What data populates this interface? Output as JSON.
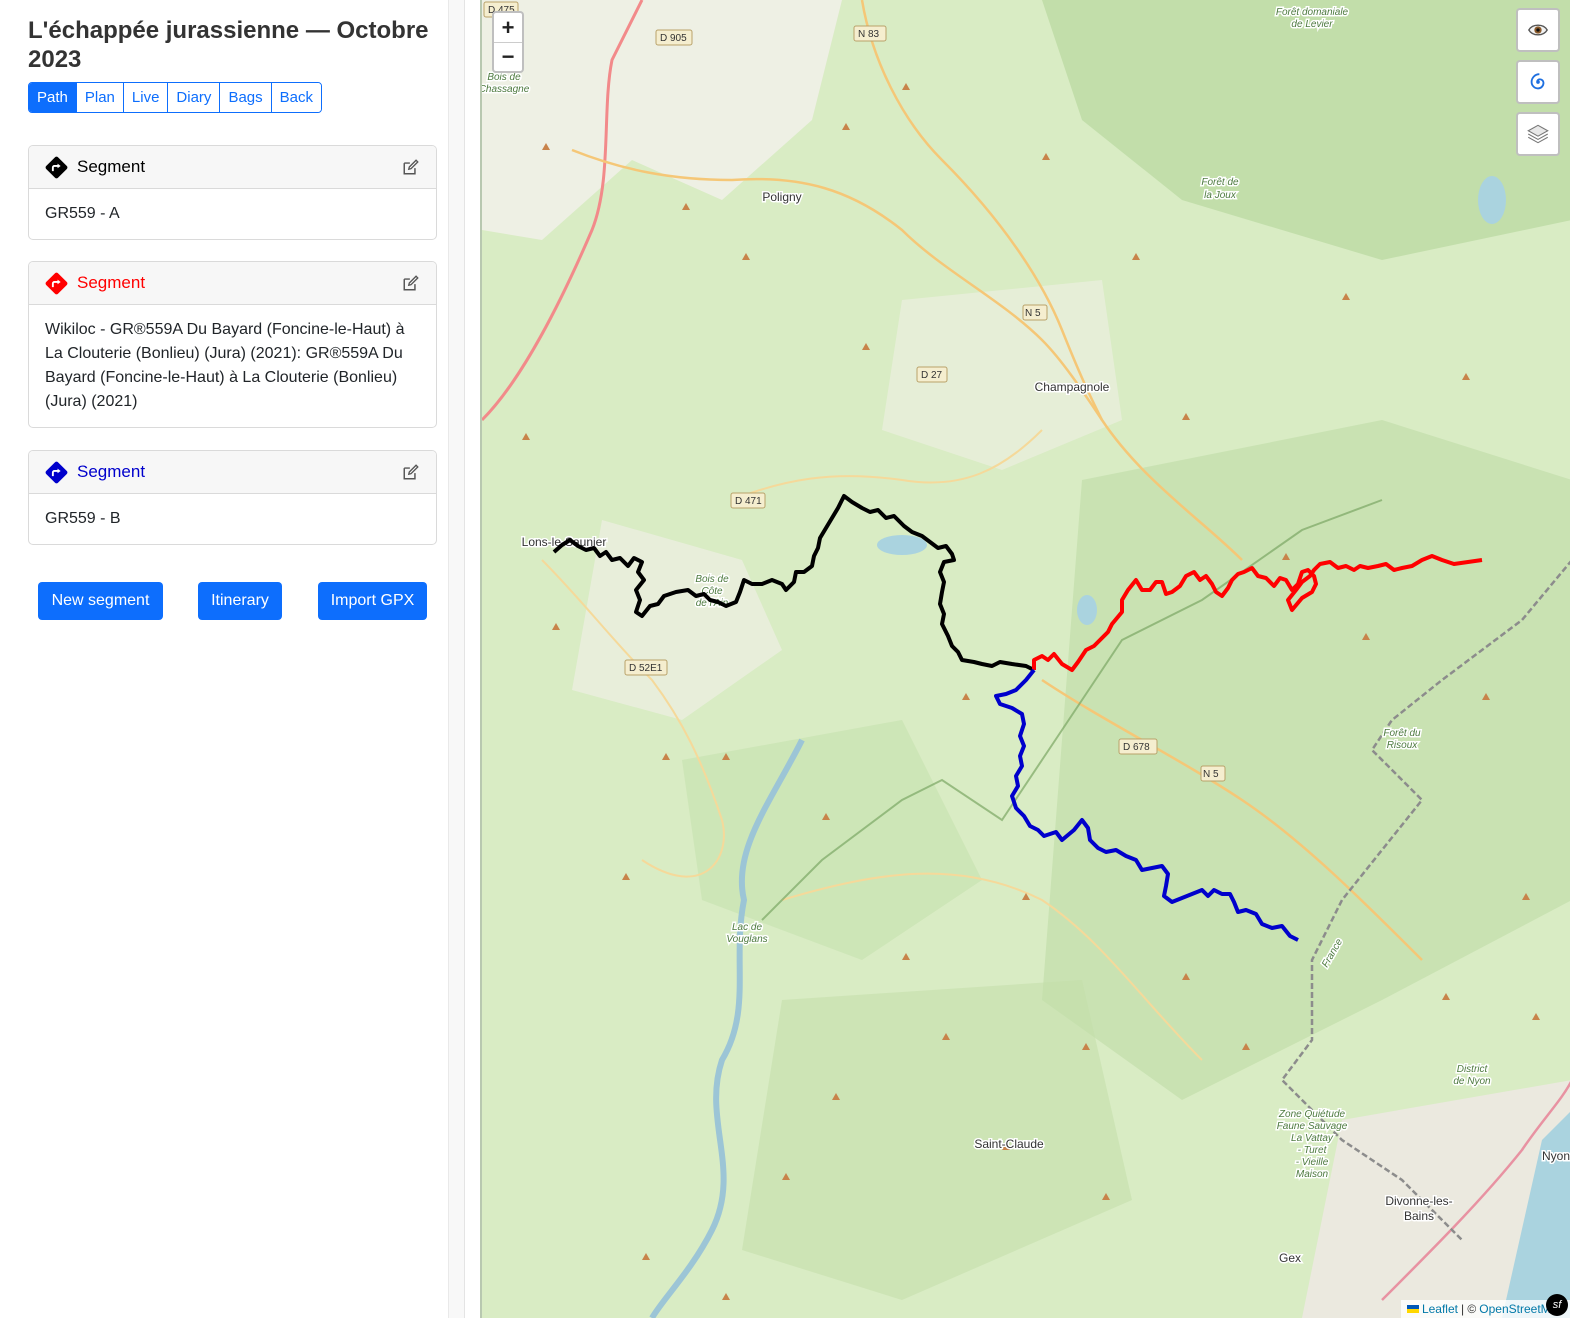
{
  "trip": {
    "title": "L'échappée jurassienne — Octobre 2023"
  },
  "tabs": [
    {
      "label": "Path",
      "active": true
    },
    {
      "label": "Plan",
      "active": false
    },
    {
      "label": "Live",
      "active": false
    },
    {
      "label": "Diary",
      "active": false
    },
    {
      "label": "Bags",
      "active": false
    },
    {
      "label": "Back",
      "active": false
    }
  ],
  "segments": [
    {
      "heading": "Segment",
      "color": "#000000",
      "icon": "turn-right-diamond-icon",
      "description": "GR559 - A"
    },
    {
      "heading": "Segment",
      "color": "#ff0000",
      "icon": "turn-right-diamond-icon",
      "description": "Wikiloc - GR®559A Du Bayard (Foncine-le-Haut) à La Clouterie (Bonlieu) (Jura) (2021): GR®559A Du Bayard (Foncine-le-Haut) à La Clouterie (Bonlieu) (Jura) (2021)"
    },
    {
      "heading": "Segment",
      "color": "#0000cc",
      "icon": "turn-right-diamond-icon",
      "description": "GR559 - B"
    }
  ],
  "actions": {
    "new_segment": "New segment",
    "itinerary": "Itinerary",
    "import_gpx": "Import GPX"
  },
  "map": {
    "zoom_in": "+",
    "zoom_out": "−",
    "controls": [
      "eye-icon",
      "spiral-icon",
      "layers-icon"
    ],
    "places": {
      "lons": "Lons-le-Saunier",
      "poligny": "Poligny",
      "champagnole": "Champagnole",
      "saint_claude": "Saint-Claude",
      "gex": "Gex",
      "divonne1": "Divonne-les-",
      "divonne2": "Bains",
      "nyon": "Nyon",
      "france": "France"
    },
    "forest_labels": {
      "levier1": "Forêt domaniale",
      "levier2": "de Levier",
      "joux1": "Forêt de",
      "joux2": "la Joux",
      "risoux1": "Forêt du",
      "risoux2": "Risoux",
      "vouglans1": "Lac de",
      "vouglans2": "Vouglans",
      "bois1": "Bois de",
      "bois2": "Chassagne",
      "nyon_district1": "District",
      "nyon_district2": "de Nyon",
      "zone1": "Zone Quiétude",
      "zone2": "Faune Sauvage",
      "zone3": "La Vattay",
      "zone4": "- Turet",
      "zone5": "- Vieille",
      "zone6": "Maison",
      "cote1": "Bois de",
      "cote2": "Côte",
      "cote3": "de l'Ain"
    },
    "roads": {
      "d475": "D 475",
      "d905": "D 905",
      "n83": "N 83",
      "n5a": "N 5",
      "d27": "D 27",
      "d471": "D 471",
      "d52e1": "D 52E1",
      "d678": "D 678",
      "n5b": "N 5"
    },
    "attribution": {
      "leaflet": "Leaflet",
      "separator": "| ©",
      "osm": "OpenStreetMap"
    },
    "track_colors": {
      "a": "#000000",
      "b_variant": "#ff0000",
      "b": "#0000cc"
    }
  }
}
